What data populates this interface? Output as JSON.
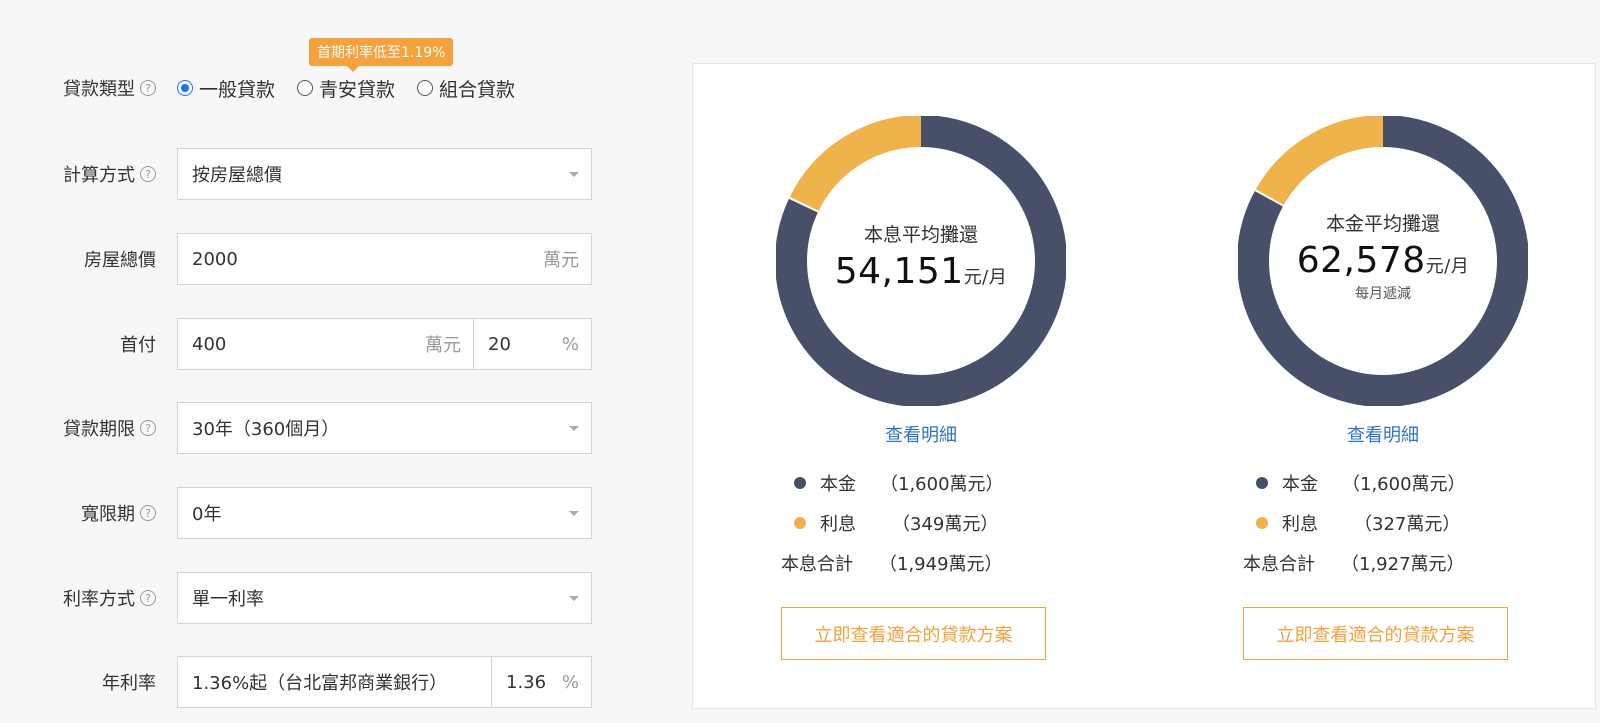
{
  "form": {
    "loan_type": {
      "label": "貸款類型",
      "options": [
        "一般貸款",
        "青安貸款",
        "組合貸款"
      ],
      "selected": "一般貸款",
      "tooltip": "首期利率低至1.19%"
    },
    "calc_method": {
      "label": "計算方式",
      "value": "按房屋總價"
    },
    "house_price": {
      "label": "房屋總價",
      "value": "2000",
      "unit": "萬元"
    },
    "down_payment": {
      "label": "首付",
      "value": "400",
      "unit": "萬元",
      "percent": "20",
      "percent_unit": "%"
    },
    "loan_term": {
      "label": "貸款期限",
      "value": "30年（360個月）"
    },
    "grace_period": {
      "label": "寬限期",
      "value": "0年"
    },
    "rate_type": {
      "label": "利率方式",
      "value": "單一利率"
    },
    "annual_rate": {
      "label": "年利率",
      "bank_value": "1.36%起（台北富邦商業銀行）",
      "rate": "1.36",
      "unit": "%"
    }
  },
  "results": [
    {
      "title": "本息平均攤還",
      "amount": "54,151",
      "per": "元/月",
      "sub": "",
      "detail_link": "查看明細",
      "principal_label": "本金",
      "principal_value": "（1,600萬元）",
      "interest_label": "利息",
      "interest_value": "（349萬元）",
      "total_label": "本息合計",
      "total_value": "（1,949萬元）",
      "cta": "立即查看適合的貸款方案"
    },
    {
      "title": "本金平均攤還",
      "amount": "62,578",
      "per": "元/月",
      "sub": "每月遞減",
      "detail_link": "查看明細",
      "principal_label": "本金",
      "principal_value": "（1,600萬元）",
      "interest_label": "利息",
      "interest_value": "（327萬元）",
      "total_label": "本息合計",
      "total_value": "（1,927萬元）",
      "cta": "立即查看適合的貸款方案"
    }
  ],
  "chart_data": [
    {
      "type": "pie",
      "categories": [
        "本金",
        "利息"
      ],
      "values": [
        1600,
        349
      ]
    },
    {
      "type": "pie",
      "categories": [
        "本金",
        "利息"
      ],
      "values": [
        1600,
        327
      ]
    }
  ],
  "colors": {
    "principal": "#474f69",
    "interest": "#f0b24a",
    "accent": "#f5a13c",
    "link": "#2f73c7",
    "radio": "#1a73e8"
  },
  "icons": {
    "help": "question-circle-icon",
    "caret": "caret-down-icon"
  }
}
